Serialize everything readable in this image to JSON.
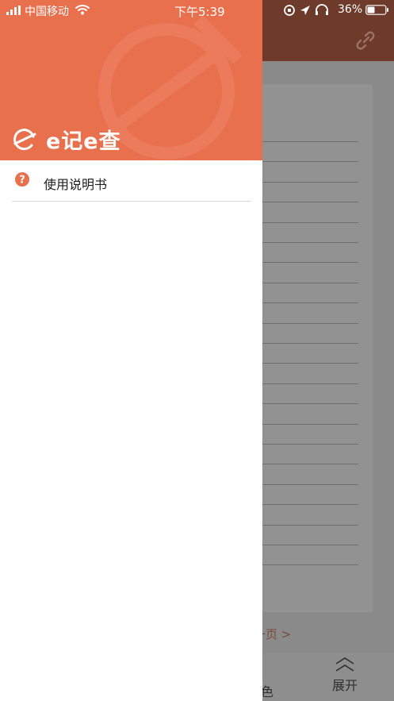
{
  "status_bar": {
    "carrier": "中国移动",
    "time": "下午5:39",
    "battery": "36%"
  },
  "drawer": {
    "logo_text": "e记e查",
    "menu_items": [
      {
        "label": "使用说明书",
        "icon": "question-circle-icon"
      }
    ]
  },
  "background": {
    "next_page": "一页 >",
    "expand_label": "展开",
    "color_label": "色"
  },
  "colors": {
    "accent": "#e8704d",
    "bg_header_dim": "#6e3a2a",
    "overlay_gray": "#8a8a8a"
  }
}
